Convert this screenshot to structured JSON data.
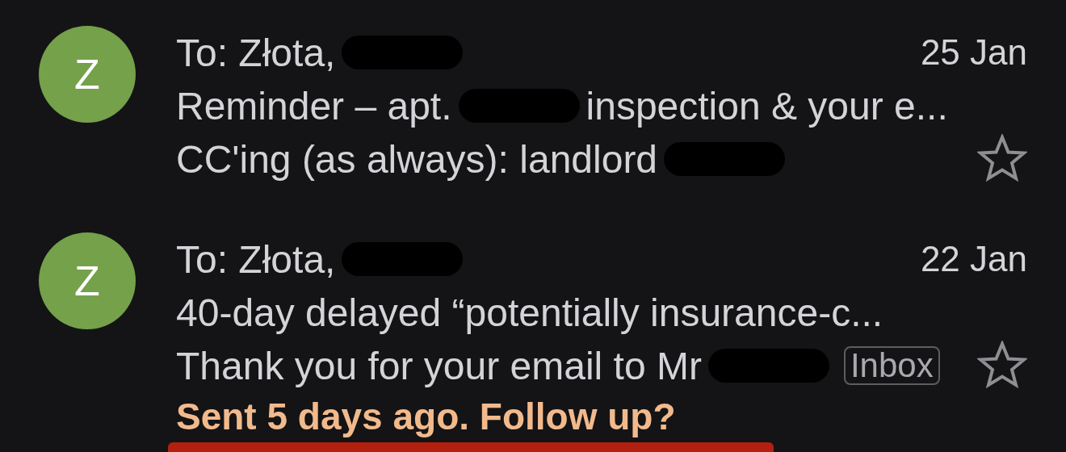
{
  "emails": [
    {
      "avatar": "Z",
      "color": "#74a14a",
      "date": "25 Jan",
      "starred": false,
      "recipient": [
        {
          "kind": "text",
          "text": "To: Złota,"
        },
        {
          "kind": "redaction"
        }
      ],
      "subject": [
        {
          "kind": "text",
          "text": "Reminder – apt."
        },
        {
          "kind": "redaction"
        },
        {
          "kind": "text",
          "text": "inspection & your e..."
        }
      ],
      "preview": [
        {
          "kind": "text",
          "text": "CC'ing (as always): landlord"
        },
        {
          "kind": "redaction"
        }
      ]
    },
    {
      "avatar": "Z",
      "color": "#74a14a",
      "date": "22 Jan",
      "starred": false,
      "recipient": [
        {
          "kind": "text",
          "text": "To: Złota,"
        },
        {
          "kind": "redaction"
        }
      ],
      "subject": [
        {
          "kind": "text",
          "text": "40-day delayed “potentially insurance-c..."
        }
      ],
      "preview": [
        {
          "kind": "text",
          "text": "Thank you for your email to Mr"
        },
        {
          "kind": "redaction"
        },
        {
          "kind": "label",
          "text": "Inbox"
        }
      ],
      "nudge": "Sent 5 days ago. Follow up?"
    }
  ]
}
